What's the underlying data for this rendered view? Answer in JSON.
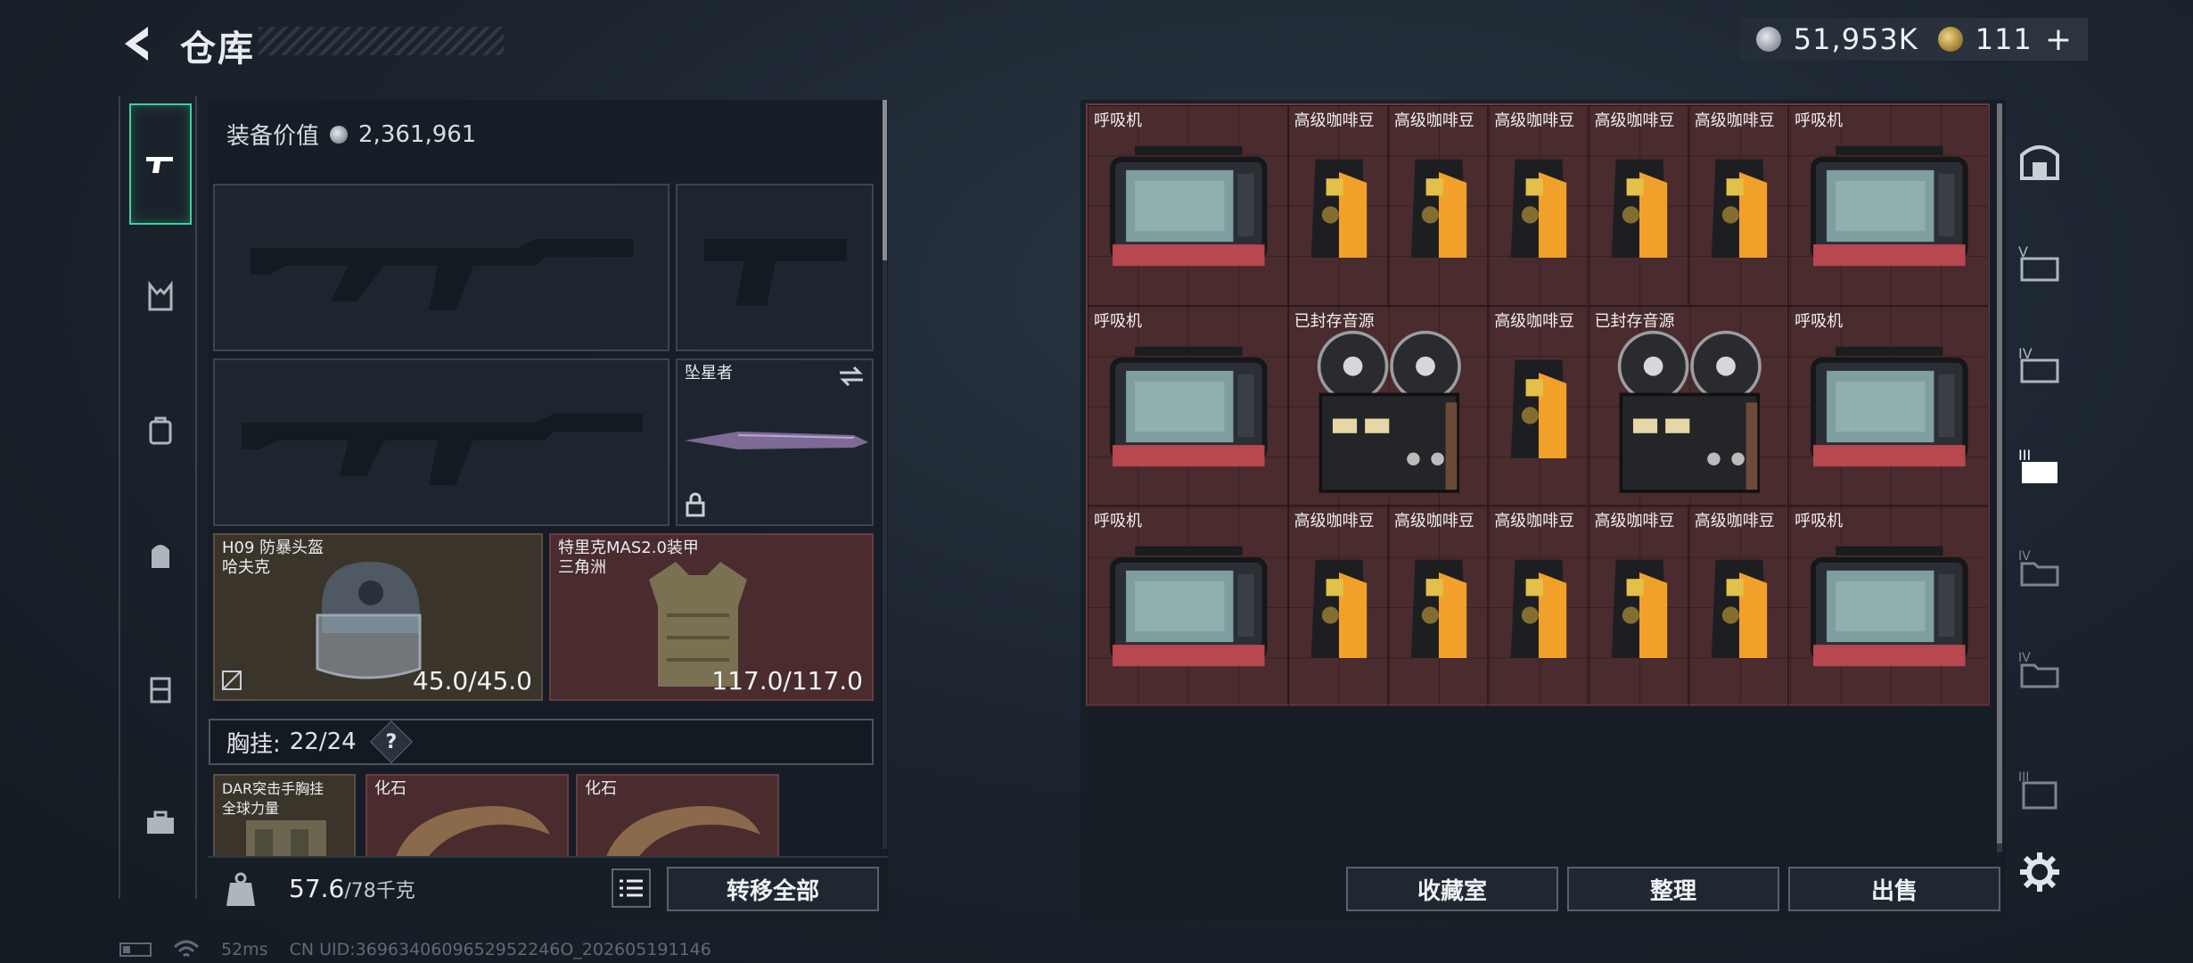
{
  "header": {
    "title": "仓库"
  },
  "currency": {
    "silver_value": "51,953K",
    "gold_value": "111",
    "gold_plus": "+"
  },
  "equipment": {
    "value_label": "装备价值",
    "value": "2,361,961",
    "melee_slot_label": "坠星者",
    "helmet": {
      "name": "H09 防暴头盔",
      "sub": "哈夫克",
      "durability": "45.0/45.0"
    },
    "armor": {
      "name": "特里克MAS2.0装甲",
      "sub": "三角洲",
      "durability": "117.0/117.0"
    },
    "vest": {
      "label": "胸挂:",
      "count": "22/24",
      "help": "?"
    },
    "vest_item": {
      "name": "DAR突击手胸挂",
      "sub": "全球力量"
    },
    "pouch_items": [
      {
        "name": "化石"
      },
      {
        "name": "化石"
      }
    ],
    "weight": {
      "current": "57.6",
      "max": "/78千克"
    },
    "transfer_all": "转移全部"
  },
  "storage": {
    "items": [
      {
        "label": "呼吸机",
        "type": "ventilator"
      },
      {
        "label": "高级咖啡豆",
        "type": "coffee"
      },
      {
        "label": "高级咖啡豆",
        "type": "coffee"
      },
      {
        "label": "高级咖啡豆",
        "type": "coffee"
      },
      {
        "label": "高级咖啡豆",
        "type": "coffee"
      },
      {
        "label": "高级咖啡豆",
        "type": "coffee"
      },
      {
        "label": "呼吸机",
        "type": "ventilator"
      },
      {
        "label": "呼吸机",
        "type": "ventilator"
      },
      {
        "label": "已封存音源",
        "type": "tape"
      },
      {
        "label": "高级咖啡豆",
        "type": "coffee"
      },
      {
        "label": "已封存音源",
        "type": "tape"
      },
      {
        "label": "呼吸机",
        "type": "ventilator"
      },
      {
        "label": "呼吸机",
        "type": "ventilator"
      },
      {
        "label": "高级咖啡豆",
        "type": "coffee"
      },
      {
        "label": "高级咖啡豆",
        "type": "coffee"
      },
      {
        "label": "高级咖啡豆",
        "type": "coffee"
      },
      {
        "label": "高级咖啡豆",
        "type": "coffee"
      },
      {
        "label": "高级咖啡豆",
        "type": "coffee"
      },
      {
        "label": "呼吸机",
        "type": "ventilator"
      }
    ],
    "actions": {
      "collection": "收藏室",
      "sort": "整理",
      "sell": "出售"
    }
  },
  "status": {
    "ping": "52ms",
    "uid": "CN UID:3696340609652952246O_202605191146"
  },
  "colors": {
    "accent": "#3fd39a",
    "storage_bg": "#4a2b2e",
    "helmet_bg": "#3b342b"
  }
}
